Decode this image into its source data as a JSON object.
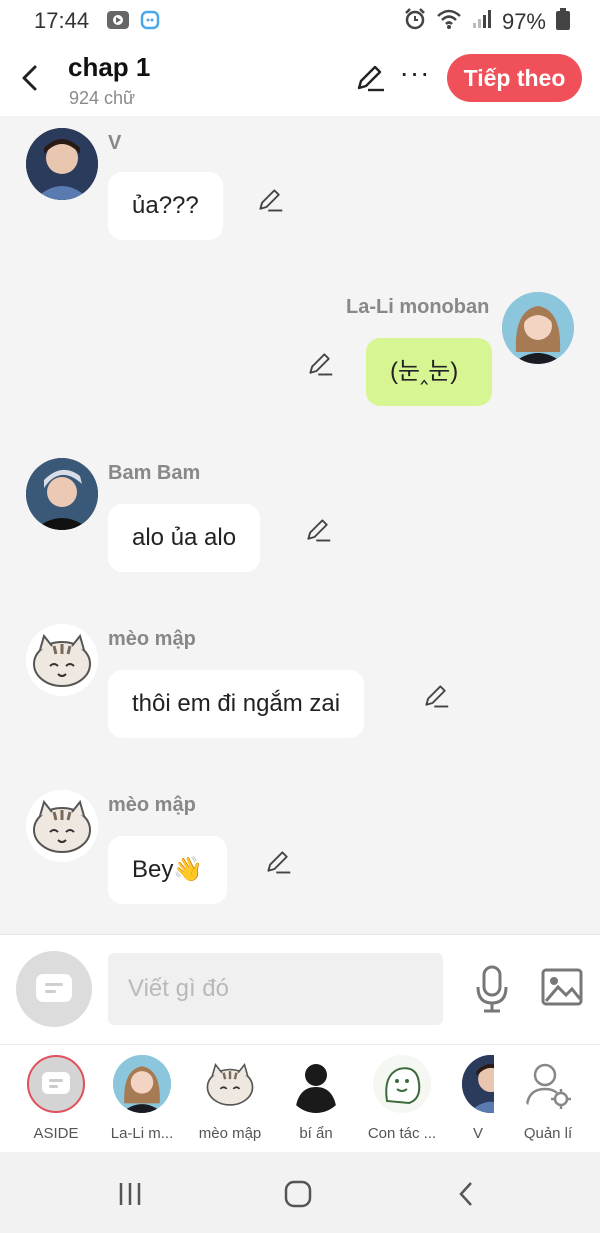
{
  "status": {
    "time": "17:44",
    "battery": "97%"
  },
  "header": {
    "title": "chap 1",
    "word_count": "924 chữ",
    "next_label": "Tiếp theo"
  },
  "messages": [
    {
      "sender": "V",
      "text": "ủa???",
      "side": "left"
    },
    {
      "sender": "La-Li monoban",
      "text": "(눈‸눈)",
      "side": "right"
    },
    {
      "sender": "Bam Bam",
      "text": "alo ủa alo",
      "side": "left"
    },
    {
      "sender": "mèo mập",
      "text": "thôi em đi ngắm zai",
      "side": "left"
    },
    {
      "sender": "mèo mập",
      "text": "Bey👋",
      "side": "left"
    }
  ],
  "compose": {
    "placeholder": "Viết gì đó"
  },
  "characters": [
    {
      "label": "ASIDE"
    },
    {
      "label": "La-Li m..."
    },
    {
      "label": "mèo mập"
    },
    {
      "label": "bí ẩn"
    },
    {
      "label": "Con tác ..."
    },
    {
      "label": "V"
    },
    {
      "label": "Quản lí"
    }
  ],
  "colors": {
    "accent": "#f0505a",
    "my_bubble": "#d8f593",
    "background": "#f4f4f4"
  },
  "icons": [
    "back-icon",
    "edit-icon",
    "more-icon",
    "mic-icon",
    "image-icon",
    "settings-user-icon",
    "recent-apps-icon",
    "home-icon",
    "nav-back-icon"
  ]
}
